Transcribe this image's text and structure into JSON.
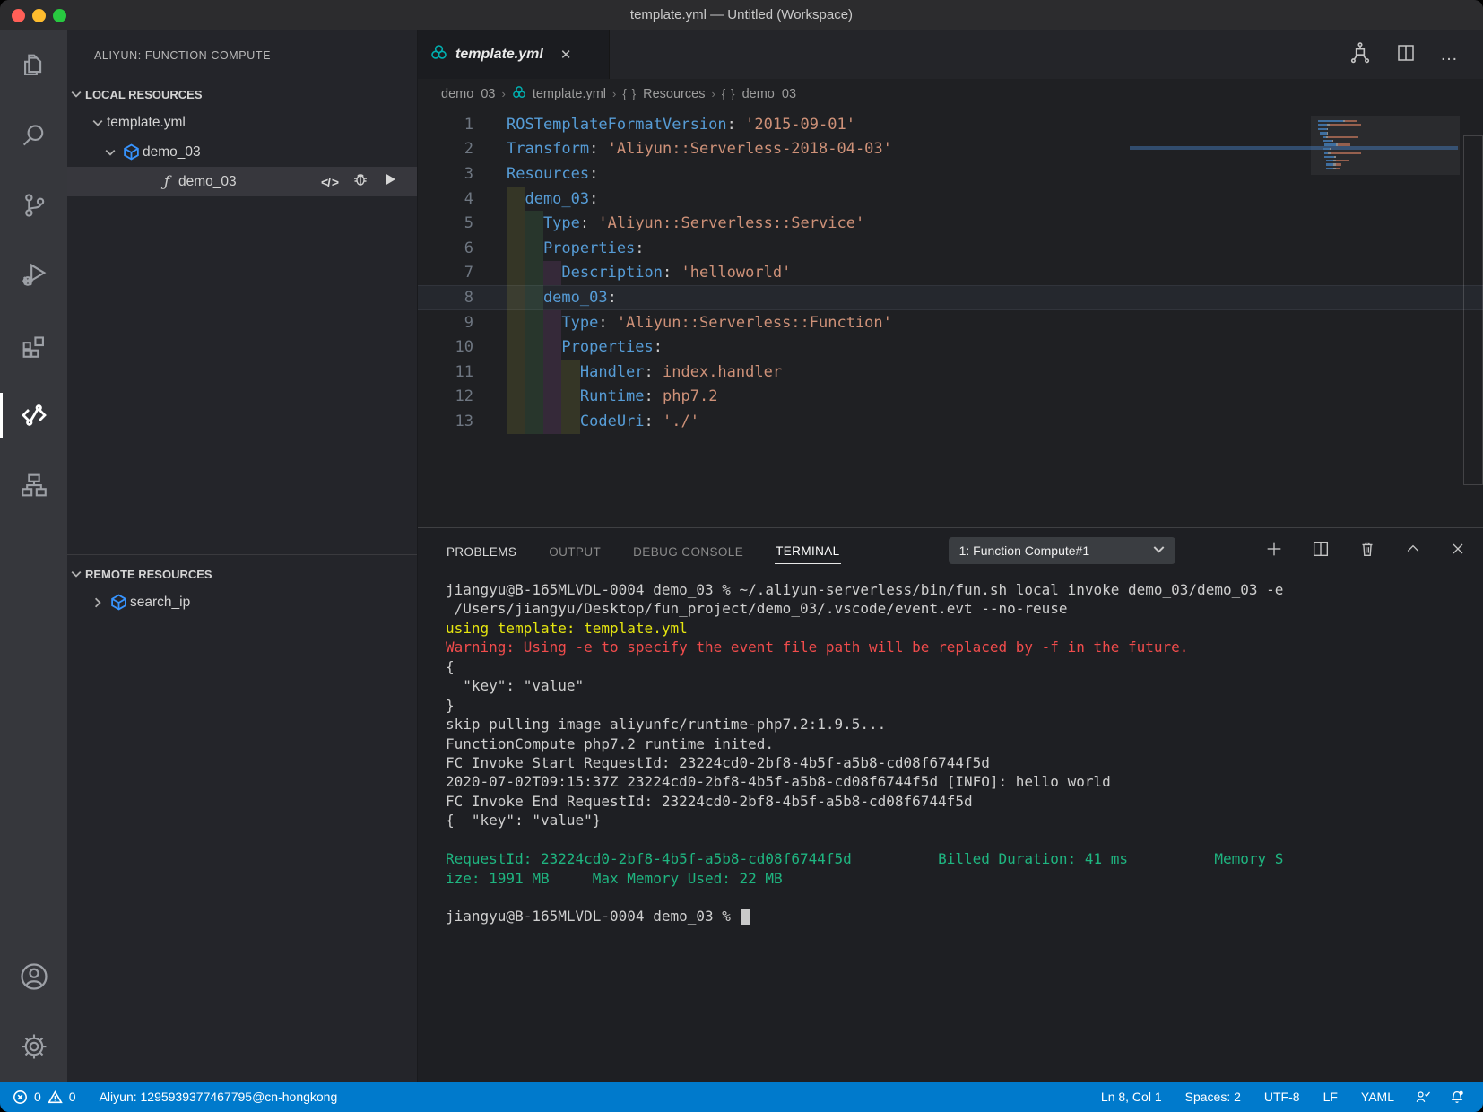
{
  "window": {
    "title": "template.yml — Untitled (Workspace)"
  },
  "activity_bar": {
    "items": [
      "explorer",
      "search",
      "source-control",
      "run-debug",
      "extensions",
      "aliyun-serverless",
      "resource-deploy"
    ],
    "bottom_items": [
      "account",
      "settings"
    ]
  },
  "sidebar": {
    "title": "ALIYUN: FUNCTION COMPUTE",
    "local": {
      "header": "LOCAL RESOURCES",
      "rows": [
        {
          "label": "template.yml",
          "chevron": "down",
          "icon": "",
          "pad": 24,
          "selected": false,
          "actions": []
        },
        {
          "label": "demo_03",
          "chevron": "down",
          "icon": "cube",
          "pad": 38,
          "selected": false,
          "actions": []
        },
        {
          "label": "demo_03",
          "chevron": "",
          "icon": "function",
          "pad": 78,
          "selected": true,
          "actions": [
            "code",
            "bug",
            "run"
          ]
        }
      ]
    },
    "remote": {
      "header": "REMOTE RESOURCES",
      "rows": [
        {
          "label": "search_ip",
          "chevron": "right",
          "icon": "cube",
          "pad": 24,
          "selected": false,
          "actions": []
        }
      ]
    }
  },
  "editor": {
    "tab": {
      "label": "template.yml",
      "close": "✕"
    },
    "breadcrumb": [
      {
        "label": "demo_03",
        "icon": ""
      },
      {
        "label": "template.yml",
        "icon": "aliyun"
      },
      {
        "label": "Resources",
        "icon": "braces"
      },
      {
        "label": "demo_03",
        "icon": "braces"
      }
    ],
    "lines": [
      {
        "n": 1,
        "ind": [],
        "tokens": [
          [
            "k",
            "ROSTemplateFormatVersion"
          ],
          [
            "p",
            ": "
          ],
          [
            "s",
            "'2015-09-01'"
          ]
        ]
      },
      {
        "n": 2,
        "ind": [],
        "tokens": [
          [
            "k",
            "Transform"
          ],
          [
            "p",
            ": "
          ],
          [
            "s",
            "'Aliyun::Serverless-2018-04-03'"
          ]
        ]
      },
      {
        "n": 3,
        "ind": [],
        "tokens": [
          [
            "k",
            "Resources"
          ],
          [
            "p",
            ":"
          ]
        ]
      },
      {
        "n": 4,
        "ind": [
          2
        ],
        "tokens": [
          [
            "k",
            "demo_03"
          ],
          [
            "p",
            ":"
          ]
        ]
      },
      {
        "n": 5,
        "ind": [
          2,
          2
        ],
        "tokens": [
          [
            "k",
            "Type"
          ],
          [
            "p",
            ": "
          ],
          [
            "s",
            "'Aliyun::Serverless::Service'"
          ]
        ]
      },
      {
        "n": 6,
        "ind": [
          2,
          2
        ],
        "tokens": [
          [
            "k",
            "Properties"
          ],
          [
            "p",
            ":"
          ]
        ]
      },
      {
        "n": 7,
        "ind": [
          2,
          2,
          2
        ],
        "tokens": [
          [
            "k",
            "Description"
          ],
          [
            "p",
            ": "
          ],
          [
            "s",
            "'helloworld'"
          ]
        ]
      },
      {
        "n": 8,
        "ind": [
          2,
          2
        ],
        "tokens": [
          [
            "k",
            "demo_03"
          ],
          [
            "p",
            ":"
          ]
        ],
        "current": true
      },
      {
        "n": 9,
        "ind": [
          2,
          2,
          2
        ],
        "tokens": [
          [
            "k",
            "Type"
          ],
          [
            "p",
            ": "
          ],
          [
            "s",
            "'Aliyun::Serverless::Function'"
          ]
        ]
      },
      {
        "n": 10,
        "ind": [
          2,
          2,
          2
        ],
        "tokens": [
          [
            "k",
            "Properties"
          ],
          [
            "p",
            ":"
          ]
        ]
      },
      {
        "n": 11,
        "ind": [
          2,
          2,
          2,
          2
        ],
        "tokens": [
          [
            "k",
            "Handler"
          ],
          [
            "p",
            ": "
          ],
          [
            "s",
            "index.handler"
          ]
        ]
      },
      {
        "n": 12,
        "ind": [
          2,
          2,
          2,
          2
        ],
        "tokens": [
          [
            "k",
            "Runtime"
          ],
          [
            "p",
            ": "
          ],
          [
            "s",
            "php7.2"
          ]
        ]
      },
      {
        "n": 13,
        "ind": [
          2,
          2,
          2,
          2
        ],
        "tokens": [
          [
            "k",
            "CodeUri"
          ],
          [
            "p",
            ": "
          ],
          [
            "s",
            "'./'"
          ]
        ]
      }
    ]
  },
  "panel": {
    "tabs": [
      {
        "label": "PROBLEMS",
        "state": "bright"
      },
      {
        "label": "OUTPUT",
        "state": ""
      },
      {
        "label": "DEBUG CONSOLE",
        "state": ""
      },
      {
        "label": "TERMINAL",
        "state": "active"
      }
    ],
    "dropdown": "1: Function Compute#1",
    "terminal_lines": [
      {
        "c": "",
        "t": "jiangyu@B-165MLVDL-0004 demo_03 % ~/.aliyun-serverless/bin/fun.sh local invoke demo_03/demo_03 -e"
      },
      {
        "c": "",
        "t": " /Users/jiangyu/Desktop/fun_project/demo_03/.vscode/event.evt --no-reuse"
      },
      {
        "c": "yellow",
        "t": "using template: template.yml"
      },
      {
        "c": "red",
        "t": "Warning: Using -e to specify the event file path will be replaced by -f in the future."
      },
      {
        "c": "",
        "t": "{"
      },
      {
        "c": "",
        "t": "  \"key\": \"value\""
      },
      {
        "c": "",
        "t": "}"
      },
      {
        "c": "",
        "t": "skip pulling image aliyunfc/runtime-php7.2:1.9.5..."
      },
      {
        "c": "",
        "t": "FunctionCompute php7.2 runtime inited."
      },
      {
        "c": "",
        "t": "FC Invoke Start RequestId: 23224cd0-2bf8-4b5f-a5b8-cd08f6744f5d"
      },
      {
        "c": "",
        "t": "2020-07-02T09:15:37Z 23224cd0-2bf8-4b5f-a5b8-cd08f6744f5d [INFO]: hello world"
      },
      {
        "c": "",
        "t": "FC Invoke End RequestId: 23224cd0-2bf8-4b5f-a5b8-cd08f6744f5d"
      },
      {
        "c": "",
        "t": "{  \"key\": \"value\"}"
      },
      {
        "c": "",
        "t": ""
      },
      {
        "c": "green",
        "t": "RequestId: 23224cd0-2bf8-4b5f-a5b8-cd08f6744f5d          Billed Duration: 41 ms          Memory S"
      },
      {
        "c": "green",
        "t": "ize: 1991 MB     Max Memory Used: 22 MB"
      },
      {
        "c": "",
        "t": ""
      },
      {
        "c": "",
        "t": "jiangyu@B-165MLVDL-0004 demo_03 % ",
        "cursor": true
      }
    ]
  },
  "status_bar": {
    "errors": "0",
    "warnings": "0",
    "account": "Aliyun: 1295939377467795@cn-hongkong",
    "right": [
      "Ln 8, Col 1",
      "Spaces: 2",
      "UTF-8",
      "LF",
      "YAML"
    ]
  },
  "colors": {
    "accent": "#007acc",
    "yaml_key": "#569cd6",
    "yaml_string": "#ce9178",
    "terminal_green": "#1fb580",
    "terminal_red": "#f14c4c",
    "terminal_yellow": "#e5e510",
    "cube_icon_blue": "#3794ff",
    "aliyun_teal": "#00b0b0"
  }
}
